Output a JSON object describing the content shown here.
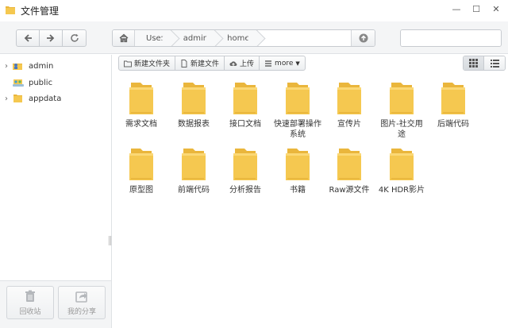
{
  "window": {
    "title": "文件管理",
    "minimize": "—",
    "maximize": "☐",
    "close": "✕"
  },
  "breadcrumb": [
    "User",
    "admin",
    "home"
  ],
  "search": {
    "placeholder": ""
  },
  "sidebar": {
    "items": [
      {
        "label": "admin",
        "icon": "user-folder-icon",
        "expandable": true
      },
      {
        "label": "public",
        "icon": "shared-folder-icon",
        "expandable": false
      },
      {
        "label": "appdata",
        "icon": "folder-icon",
        "expandable": true
      }
    ],
    "recycle_label": "回收站",
    "share_label": "我的分享"
  },
  "actions": {
    "new_folder": "新建文件夹",
    "new_file": "新建文件",
    "upload": "上传",
    "more": "more"
  },
  "files": [
    "需求文档",
    "数据报表",
    "接口文档",
    "快速部署操作系统",
    "宣传片",
    "图片-社交用途",
    "后端代码",
    "原型图",
    "前端代码",
    "分析报告",
    "书籍",
    "Raw源文件",
    "4K HDR影片"
  ],
  "colors": {
    "folder": "#f5c850",
    "folder_back": "#eab63c",
    "toolbar_bg": "#f4f5f6",
    "border": "#c7cbd0"
  }
}
